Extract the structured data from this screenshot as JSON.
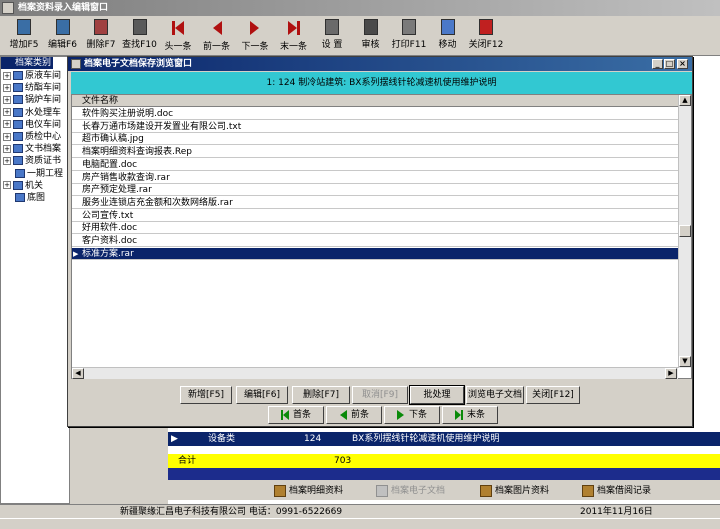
{
  "window": {
    "title": "档案资料录入编辑窗口"
  },
  "toolbar": [
    {
      "label": "增加F5",
      "icon": "document-icon"
    },
    {
      "label": "编辑F6",
      "icon": "edit-icon"
    },
    {
      "label": "删除F7",
      "icon": "delete-icon"
    },
    {
      "label": "查找F10",
      "icon": "search-icon"
    },
    {
      "label": "头一条",
      "icon": "first-record-icon"
    },
    {
      "label": "前一条",
      "icon": "prev-record-icon"
    },
    {
      "label": "下一条",
      "icon": "next-record-icon"
    },
    {
      "label": "末一条",
      "icon": "last-record-icon"
    },
    {
      "label": "设 置",
      "icon": "settings-icon"
    },
    {
      "label": "审核",
      "icon": "audit-icon"
    },
    {
      "label": "打印F11",
      "icon": "printer-icon"
    },
    {
      "label": "移动",
      "icon": "move-icon"
    },
    {
      "label": "关闭F12",
      "icon": "close-door-icon"
    }
  ],
  "tree": {
    "header": "档案类别",
    "items": [
      "原液车间",
      "纺酯车间",
      "锅炉车间",
      "水处理车",
      "电仪车间",
      "质检中心",
      "文书档案",
      "资质证书",
      "一期工程",
      "机关",
      "底图"
    ]
  },
  "dialog": {
    "title": "档案电子文档保存浏览窗口",
    "header": "1: 124   制冷站建筑: BX系列摆线针轮减速机使用维护说明",
    "column_header": "文件名称",
    "files": [
      "软件购买注册说明.doc",
      "长春万通市场建设开发置业有限公司.txt",
      "超市确认稿.jpg",
      "档案明细资料查询报表.Rep",
      "电脑配置.doc",
      "房产销售收款查询.rar",
      "房产预定处理.rar",
      "服务业连锁店充金额和次数网络版.rar",
      "公司宣传.txt",
      "好用软件.doc",
      "客户资料.doc",
      "标准方案.rar"
    ],
    "selected_index": 11,
    "buttons": [
      "新增[F5]",
      "编辑[F6]",
      "删除[F7]",
      "取消[F9]",
      "批处理",
      "浏览电子文档",
      "关闭[F12]"
    ],
    "nav": [
      "首条",
      "前条",
      "下条",
      "末条"
    ]
  },
  "grid": {
    "row": {
      "type": "设备类",
      "num": "124",
      "name": "BX系列摆线针轮减速机使用维护说明"
    },
    "total": {
      "label": "合计",
      "value": "703"
    }
  },
  "bottom_tabs": [
    "档案明细资料",
    "档案电子文档",
    "档案图片资料",
    "档案借阅记录"
  ],
  "status": {
    "company": "新疆聚缘汇昌电子科技有限公司  电话：0991-6522669",
    "date": "2011年11月16日"
  }
}
